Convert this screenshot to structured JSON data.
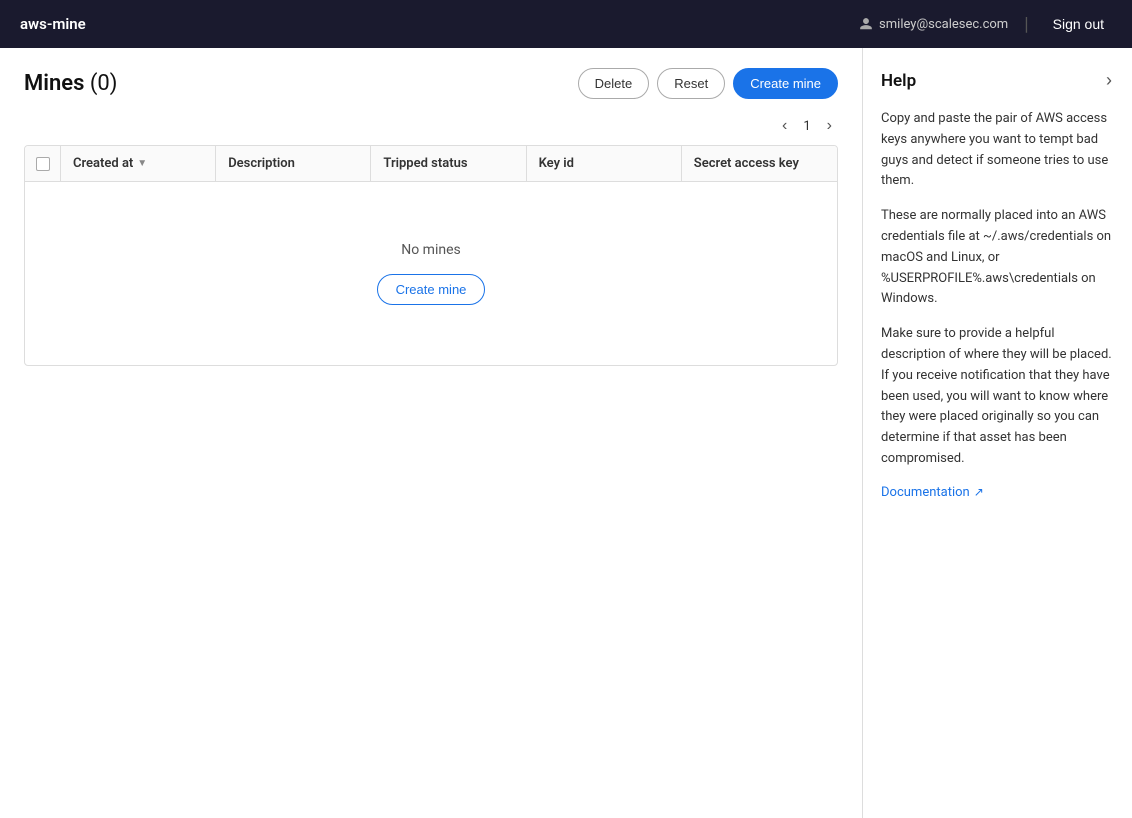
{
  "nav": {
    "brand": "aws-mine",
    "user_email": "smiley@scalesec.com",
    "signout_label": "Sign out"
  },
  "page": {
    "title": "Mines",
    "count": "(0)",
    "delete_label": "Delete",
    "reset_label": "Reset",
    "create_mine_label": "Create mine",
    "pagination": {
      "current_page": "1"
    }
  },
  "table": {
    "columns": [
      {
        "id": "created_at",
        "label": "Created at",
        "sortable": true
      },
      {
        "id": "description",
        "label": "Description",
        "sortable": false
      },
      {
        "id": "tripped_status",
        "label": "Tripped status",
        "sortable": false
      },
      {
        "id": "key_id",
        "label": "Key id",
        "sortable": false
      },
      {
        "id": "secret_access_key",
        "label": "Secret access key",
        "sortable": false
      }
    ],
    "empty_text": "No mines",
    "create_mine_inline_label": "Create mine"
  },
  "help": {
    "title": "Help",
    "paragraphs": [
      "Copy and paste the pair of AWS access keys anywhere you want to tempt bad guys and detect if someone tries to use them.",
      "These are normally placed into an AWS credentials file at ~/.aws/credentials on macOS and Linux, or %USERPROFILE%.aws\\credentials on Windows.",
      "Make sure to provide a helpful description of where they will be placed. If you receive notification that they have been used, you will want to know where they were placed originally so you can determine if that asset has been compromised."
    ],
    "doc_link_label": "Documentation",
    "doc_link_url": "#"
  }
}
